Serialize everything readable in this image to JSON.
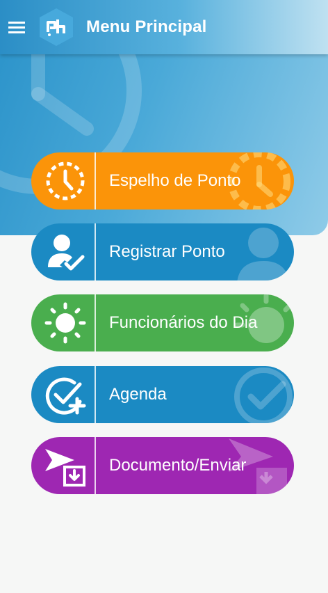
{
  "header": {
    "title": "Menu Principal",
    "menu_icon": "hamburger-icon",
    "logo_icon": "ph-logo-icon"
  },
  "colors": {
    "espelho": "#fb9409",
    "registrar": "#1b8ac3",
    "funcionarios": "#4aae4e",
    "agenda": "#1b8ac3",
    "documento": "#9e27b2"
  },
  "menu": {
    "items": [
      {
        "label": "Espelho de Ponto",
        "icon": "clock-icon"
      },
      {
        "label": "Registrar Ponto",
        "icon": "user-check-icon"
      },
      {
        "label": "Funcionários do Dia",
        "icon": "sun-icon"
      },
      {
        "label": "Agenda",
        "icon": "check-circle-plus-icon"
      },
      {
        "label": "Documento/Enviar",
        "icon": "document-send-icon"
      }
    ]
  }
}
